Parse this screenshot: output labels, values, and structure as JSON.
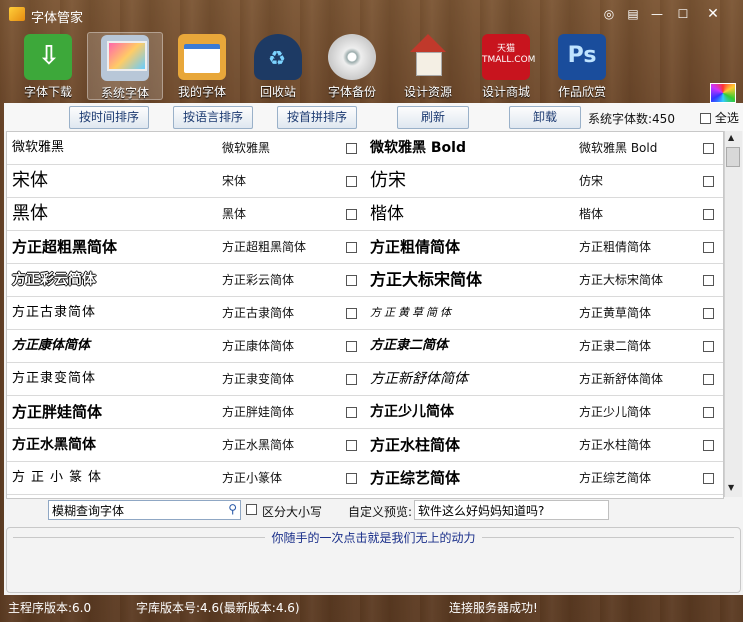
{
  "window": {
    "title": "字体管家",
    "controls": [
      "◎",
      "▤",
      "—",
      "☐",
      "✕"
    ]
  },
  "toolbar": [
    {
      "label": "字体下载",
      "icon": "download-icon",
      "color": "#3da83a"
    },
    {
      "label": "系统字体",
      "icon": "monitor-palette-icon",
      "color": "#b8c7d8"
    },
    {
      "label": "我的字体",
      "icon": "folder-icon",
      "color": "#e8a73a"
    },
    {
      "label": "回收站",
      "icon": "recycle-bin-icon",
      "color": "#1d3a64"
    },
    {
      "label": "字体备份",
      "icon": "disc-icon",
      "color": "#d9d9d9"
    },
    {
      "label": "设计资源",
      "icon": "house-icon",
      "color": "#e7e2d8"
    },
    {
      "label": "设计商城",
      "icon": "tmall-icon",
      "color": "#c8141e"
    },
    {
      "label": "作品欣赏",
      "icon": "photoshop-icon",
      "color": "#1a4d9c"
    }
  ],
  "tmall_text": "天猫\nTMALL.COM",
  "ps_text": "Ps",
  "sort": {
    "by_time": "按时间排序",
    "by_language": "按语言排序",
    "by_pinyin": "按首拼排序",
    "refresh": "刷新",
    "uninstall": "卸载",
    "count_label": "系统字体数:450",
    "select_all": "全选"
  },
  "fonts": [
    [
      {
        "sample": "微软雅黑",
        "name": "微软雅黑",
        "style": "yahei"
      },
      {
        "sample": "微软雅黑 Bold",
        "name": "微软雅黑 Bold",
        "style": "bold"
      }
    ],
    [
      {
        "sample": "宋体",
        "name": "宋体",
        "style": "song"
      },
      {
        "sample": "仿宋",
        "name": "仿宋",
        "style": "song"
      }
    ],
    [
      {
        "sample": "黑体",
        "name": "黑体",
        "style": "hei"
      },
      {
        "sample": "楷体",
        "name": "楷体",
        "style": "kai"
      }
    ],
    [
      {
        "sample": "方正超粗黑简体",
        "name": "方正超粗黑简体",
        "style": "heavy"
      },
      {
        "sample": "方正粗倩简体",
        "name": "方正粗倩简体",
        "style": "heavy"
      }
    ],
    [
      {
        "sample": "方正彩云简体",
        "name": "方正彩云简体",
        "style": "outline"
      },
      {
        "sample": "方正大标宋简体",
        "name": "方正大标宋简体",
        "style": "heavyserif"
      }
    ],
    [
      {
        "sample": "方正古隶简体",
        "name": "方正古隶简体",
        "style": "thin"
      },
      {
        "sample": "方正黄草简体",
        "name": "方正黄草简体",
        "style": "italicthin"
      }
    ],
    [
      {
        "sample": "方正康体简体",
        "name": "方正康体简体",
        "style": "kang"
      },
      {
        "sample": "方正隶二简体",
        "name": "方正隶二简体",
        "style": "kang"
      }
    ],
    [
      {
        "sample": "方正隶变简体",
        "name": "方正隶变简体",
        "style": "thin"
      },
      {
        "sample": "方正新舒体简体",
        "name": "方正新舒体简体",
        "style": "italic"
      }
    ],
    [
      {
        "sample": "方正胖娃简体",
        "name": "方正胖娃简体",
        "style": "heavy"
      },
      {
        "sample": "方正少儿简体",
        "name": "方正少儿简体",
        "style": "bold"
      }
    ],
    [
      {
        "sample": "方正水黑简体",
        "name": "方正水黑简体",
        "style": "bold"
      },
      {
        "sample": "方正水柱简体",
        "name": "方正水柱简体",
        "style": "heavy"
      }
    ],
    [
      {
        "sample": "方正小篆体",
        "name": "方正小篆体",
        "style": "seal"
      },
      {
        "sample": "方正综艺简体",
        "name": "方正综艺简体",
        "style": "heavy"
      }
    ]
  ],
  "search": {
    "value": "模糊查询字体",
    "case_label": "区分大小写",
    "preview_label": "自定义预览:",
    "preview_value": "软件这么好妈妈知道吗?"
  },
  "slogan": "你随手的一次点击就是我们无上的动力",
  "status": {
    "version": "主程序版本:6.0",
    "lib_version": "字库版本号:4.6(最新版本:4.6)",
    "connection": "连接服务器成功!"
  }
}
